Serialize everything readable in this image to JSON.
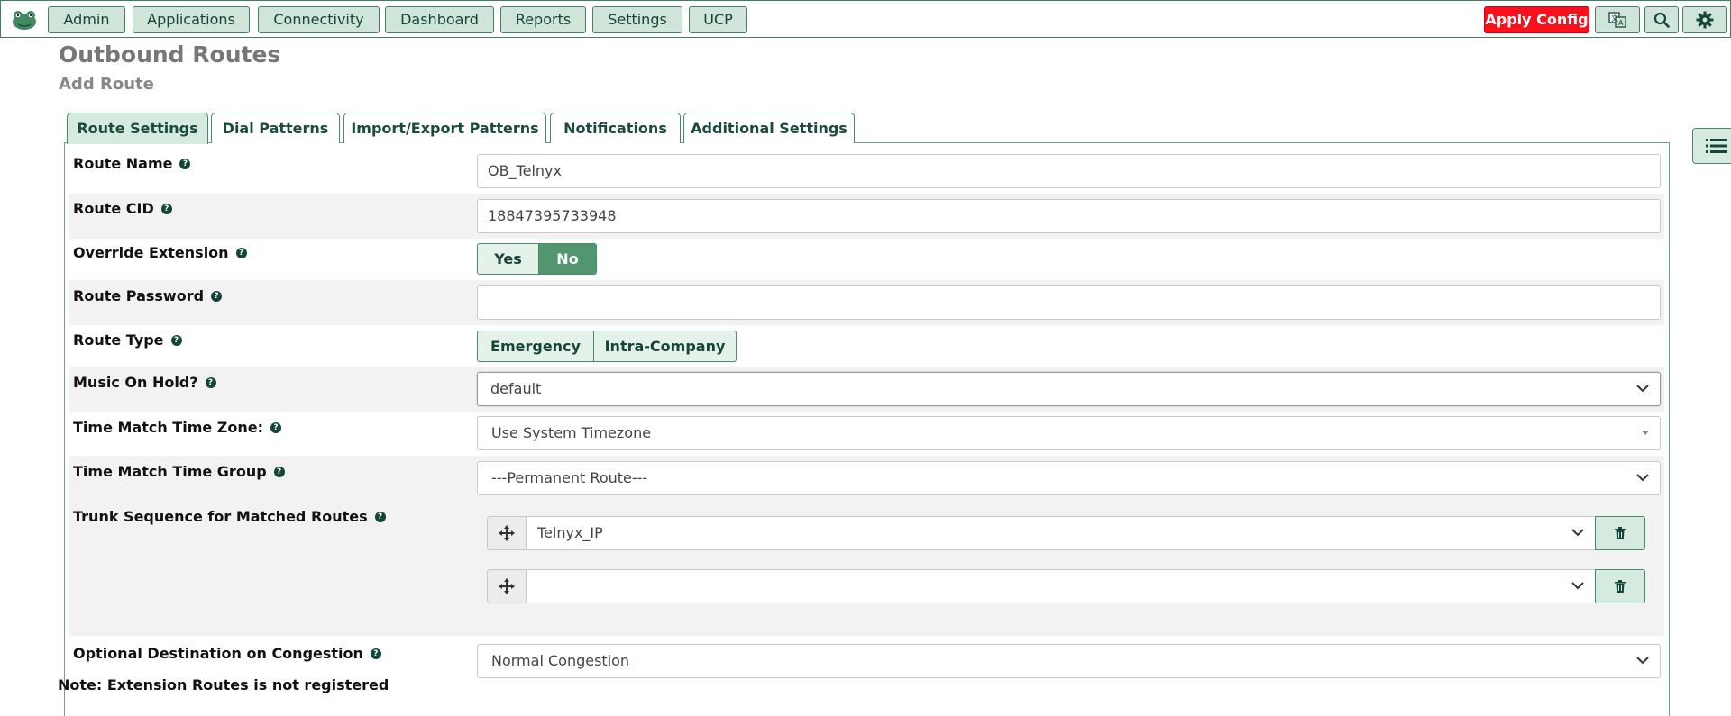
{
  "navbar": {
    "logo_icon": "frog-logo-icon",
    "menu": [
      "Admin",
      "Applications",
      "Connectivity",
      "Dashboard",
      "Reports",
      "Settings",
      "UCP"
    ],
    "apply_config": "Apply Config",
    "icons": [
      "language-icon",
      "search-icon",
      "gear-icon"
    ]
  },
  "page": {
    "title": "Outbound Routes",
    "subtitle": "Add Route"
  },
  "tabs": [
    "Route Settings",
    "Dial Patterns",
    "Import/Export Patterns",
    "Notifications",
    "Additional Settings"
  ],
  "form": {
    "route_name": {
      "label": "Route Name",
      "value": "OB_Telnyx"
    },
    "route_cid": {
      "label": "Route CID",
      "value": "18847395733948"
    },
    "override_extension": {
      "label": "Override Extension",
      "options": [
        "Yes",
        "No"
      ],
      "selected": "No"
    },
    "route_password": {
      "label": "Route Password",
      "value": ""
    },
    "route_type": {
      "label": "Route Type",
      "options": [
        "Emergency",
        "Intra-Company"
      ]
    },
    "music_on_hold": {
      "label": "Music On Hold?",
      "value": "default"
    },
    "time_zone": {
      "label": "Time Match Time Zone:",
      "value": "Use System Timezone"
    },
    "time_group": {
      "label": "Time Match Time Group",
      "value": "---Permanent Route---"
    },
    "trunk_sequence": {
      "label": "Trunk Sequence for Matched Routes",
      "trunks": [
        "Telnyx_IP",
        ""
      ]
    },
    "congestion": {
      "label": "Optional Destination on Congestion",
      "value": "Normal Congestion"
    }
  },
  "note": "Note: Extension Routes is not registered",
  "colors": {
    "accent": "#52966f",
    "nav_button": "#cfe5d9",
    "apply": "#f8101d"
  }
}
